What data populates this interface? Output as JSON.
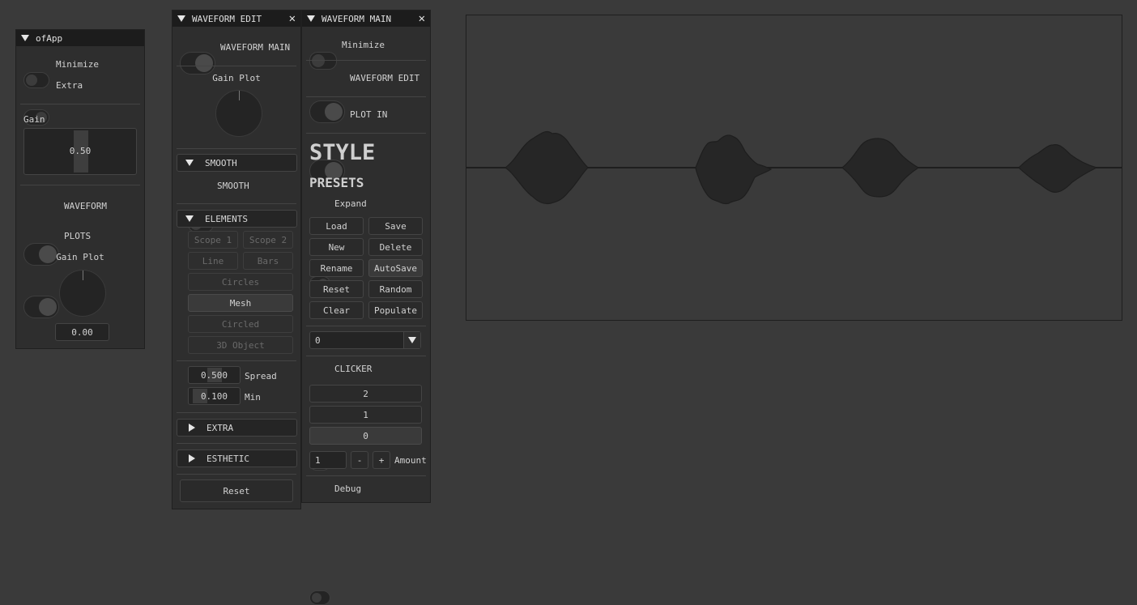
{
  "ofapp": {
    "title": "ofApp",
    "minimize": "Minimize",
    "extra": "Extra",
    "gain_label": "Gain",
    "gain_value": "0.50",
    "waveform": "WAVEFORM",
    "plots": "PLOTS",
    "gain_plot": "Gain Plot",
    "gain_plot_value": "0.00"
  },
  "edit": {
    "title": "WAVEFORM EDIT",
    "waveform_main": "WAVEFORM MAIN",
    "gain_plot": "Gain Plot",
    "smooth_section": "SMOOTH",
    "smooth_toggle": "SMOOTH",
    "elements_section": "ELEMENTS",
    "elements": {
      "scope1": "Scope 1",
      "scope2": "Scope 2",
      "line": "Line",
      "bars": "Bars",
      "circles": "Circles",
      "mesh": "Mesh",
      "circled": "Circled",
      "object3d": "3D Object"
    },
    "spread_value": "0.500",
    "spread_label": "Spread",
    "spread_fraction": 0.5,
    "min_value": "0.100",
    "min_label": "Min",
    "min_fraction": 0.1,
    "extra_section": "EXTRA",
    "esthetic_section": "ESTHETIC",
    "reset": "Reset"
  },
  "main": {
    "title": "WAVEFORM MAIN",
    "minimize": "Minimize",
    "waveform_edit": "WAVEFORM EDIT",
    "plot_in": "PLOT IN",
    "style": "STYLE",
    "presets": "PRESETS",
    "expand": "Expand",
    "buttons": {
      "load": "Load",
      "save": "Save",
      "new": "New",
      "delete": "Delete",
      "rename": "Rename",
      "autosave": "AutoSave",
      "reset": "Reset",
      "random": "Random",
      "clear": "Clear",
      "populate": "Populate"
    },
    "preset_select": "0",
    "clicker": "CLICKER",
    "clicker_items": [
      "2",
      "1",
      "0"
    ],
    "amount_value": "1",
    "minus": "-",
    "plus": "+",
    "amount_label": "Amount",
    "debug": "Debug"
  },
  "colors": {
    "background": "#3a3a3a",
    "panel": "#2e2e2e",
    "titlebar": "#1c1c1c",
    "waveform_fill": "#262626"
  },
  "icons": {
    "collapse": "triangle-down-icon",
    "expand": "triangle-right-icon",
    "close": "close-icon",
    "dropdown": "dropdown-arrow-icon"
  }
}
